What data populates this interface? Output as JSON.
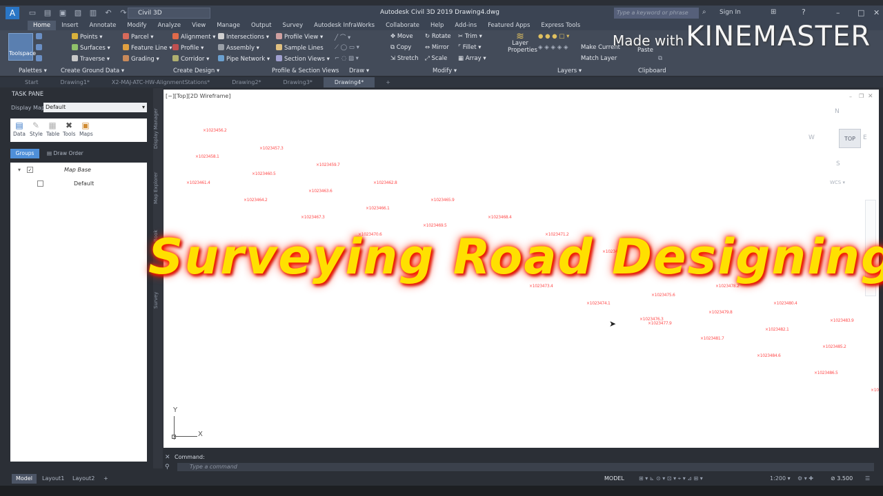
{
  "titlebar": {
    "workspace": "Civil 3D",
    "app_title": "Autodesk Civil 3D 2019    Drawing4.dwg",
    "search_placeholder": "Type a keyword or phrase",
    "sign_in": "Sign In"
  },
  "ribbon_tabs": [
    "Home",
    "Insert",
    "Annotate",
    "Modify",
    "Analyze",
    "View",
    "Manage",
    "Output",
    "Survey",
    "Autodesk InfraWorks",
    "Collaborate",
    "Help",
    "Add-ins",
    "Featured Apps",
    "Express Tools"
  ],
  "ribbon": {
    "toolspace": "Toolspace",
    "points": "Points",
    "surfaces": "Surfaces",
    "traverse": "Traverse",
    "parcel": "Parcel",
    "feature_line": "Feature Line",
    "grading": "Grading",
    "alignment": "Alignment",
    "profile": "Profile",
    "corridor": "Corridor",
    "intersections": "Intersections",
    "assembly": "Assembly",
    "pipe_network": "Pipe Network",
    "profile_view": "Profile View",
    "sample_lines": "Sample Lines",
    "section_views": "Section Views",
    "move": "Move",
    "copy": "Copy",
    "stretch": "Stretch",
    "rotate": "Rotate",
    "mirror": "Mirror",
    "scale": "Scale",
    "trim": "Trim",
    "fillet": "Fillet",
    "array": "Array",
    "layer_properties": "Layer Properties",
    "make_current": "Make Current",
    "match_layer": "Match Layer",
    "paste": "Paste",
    "panels": [
      "Palettes",
      "Create Ground Data",
      "Create Design",
      "Profile & Section Views",
      "Draw",
      "Modify",
      "Layers",
      "Clipboard"
    ]
  },
  "file_tabs": [
    "Start",
    "Drawing1*",
    "X2-MAJ-ATC-HW-AlignmentStations*",
    "Drawing2*",
    "Drawing3*",
    "Drawing4*"
  ],
  "task_pane": {
    "title": "TASK PANE",
    "display_map_label": "Display Map:",
    "display_map_value": "Default",
    "tools": [
      "Data",
      "Style",
      "Table",
      "Tools",
      "Maps"
    ],
    "groups": "Groups",
    "draw_order": "Draw Order",
    "tree": [
      {
        "label": "Map Base",
        "checked": true
      },
      {
        "label": "Default",
        "checked": false
      }
    ],
    "side_tabs": [
      "Display Manager",
      "Map Explorer",
      "Map Book",
      "Survey"
    ]
  },
  "viewport": {
    "label": "[−][Top][2D Wireframe]",
    "axis_y": "Y",
    "axis_x": "X",
    "viewcube": {
      "top": "TOP",
      "n": "N",
      "s": "S",
      "e": "E",
      "w": "W",
      "wcs": "WCS"
    },
    "overlay_text": "Surveying  Road Designing",
    "watermark_small": "Made with",
    "watermark_big": "KINEMASTER"
  },
  "command": {
    "label": "Command:",
    "placeholder": "Type a command"
  },
  "status": {
    "tabs": [
      "Model",
      "Layout1",
      "Layout2"
    ],
    "model": "MODEL",
    "scale": "1:200",
    "value": "3.500"
  }
}
